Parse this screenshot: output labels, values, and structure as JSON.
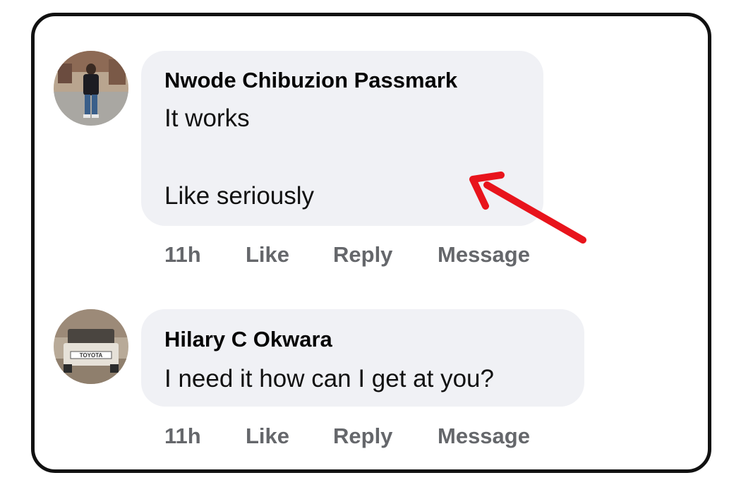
{
  "comments": [
    {
      "author": "Nwode Chibuzion Passmark",
      "text_line1": "It works",
      "text_line2": "Like seriously",
      "time": "11h",
      "like_label": "Like",
      "reply_label": "Reply",
      "message_label": "Message",
      "avatar_icon": "person-photo-avatar"
    },
    {
      "author": "Hilary C Okwara",
      "text_line1": "I need it how can I get at you?",
      "time": "11h",
      "like_label": "Like",
      "reply_label": "Reply",
      "message_label": "Message",
      "avatar_icon": "toyota-truck-photo-avatar"
    }
  ],
  "annotation": {
    "arrow_color": "#e8141c",
    "arrow_icon": "red-arrow-icon"
  },
  "colors": {
    "bubble": "#f0f1f5",
    "action_text": "#65676b",
    "frame_border": "#111111"
  }
}
